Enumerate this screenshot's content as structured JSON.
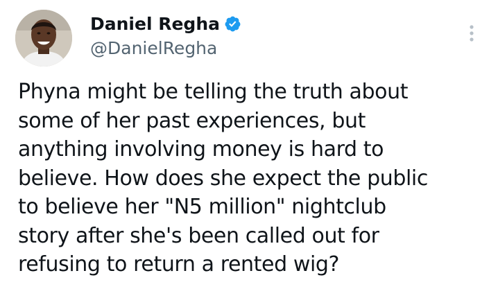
{
  "author": {
    "display_name": "Daniel Regha",
    "handle": "@DanielRegha",
    "verified": true
  },
  "tweet": {
    "lines": [
      "Phyna might be telling the truth about",
      "some of her past experiences, but",
      "anything involving money is hard to",
      "believe. How does she expect the public",
      "to believe her \"N5 million\" nightclub",
      "story after she's been called out for",
      "refusing to return a rented wig?"
    ]
  },
  "colors": {
    "verified_badge": "#1d9bf0",
    "handle_text": "#536471",
    "more_icon": "#b7c0c8"
  },
  "icons": {
    "verified": "verified-badge-icon",
    "more": "more-options-icon"
  }
}
